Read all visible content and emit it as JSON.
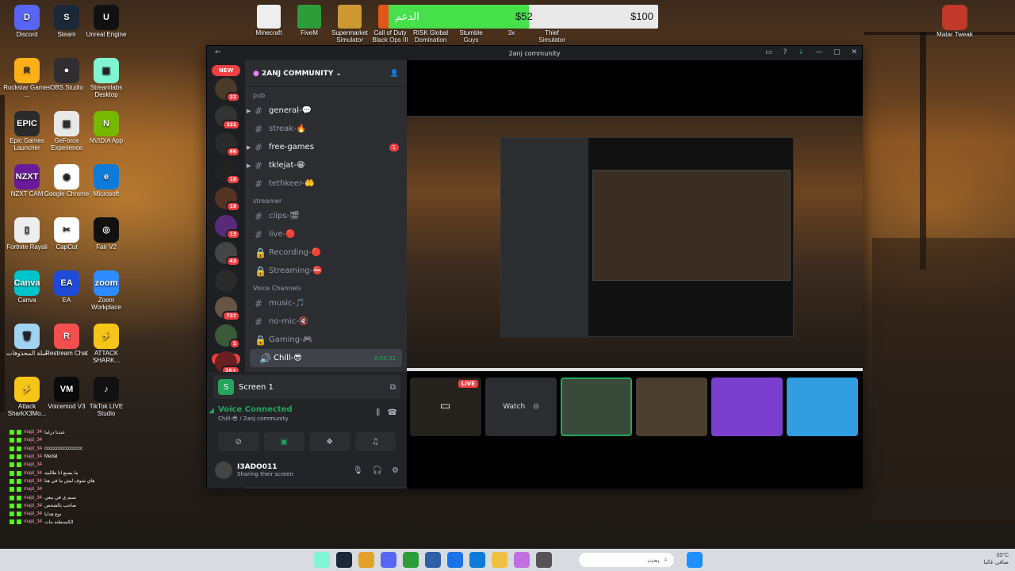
{
  "desktop": {
    "left_icons": [
      {
        "label": "Discord",
        "color": "#5865f2",
        "glyph": "D"
      },
      {
        "label": "Steam",
        "color": "#1b2838",
        "glyph": "S"
      },
      {
        "label": "Unreal Engine",
        "color": "#111111",
        "glyph": "U"
      },
      {
        "label": "Rockstar Games ...",
        "color": "#fcaf17",
        "glyph": "R"
      },
      {
        "label": "OBS Studio",
        "color": "#302e31",
        "glyph": "●"
      },
      {
        "label": "Streamlabs Desktop",
        "color": "#80f5d2",
        "glyph": "▣"
      },
      {
        "label": "Epic Games Launcher",
        "color": "#2a2a2a",
        "glyph": "EPIC"
      },
      {
        "label": "GeForce Experience",
        "color": "#e8e8e8",
        "glyph": "▥"
      },
      {
        "label": "NVIDIA App",
        "color": "#76b900",
        "glyph": "N"
      },
      {
        "label": "NZXT CAM",
        "color": "#6a1b9a",
        "glyph": "NZXT"
      },
      {
        "label": "Google Chrome",
        "color": "#ffffff",
        "glyph": "◉"
      },
      {
        "label": "Microsoft",
        "color": "#0f7bd8",
        "glyph": "e"
      },
      {
        "label": "Fortnite Rayali",
        "color": "#eeeeee",
        "glyph": "▯"
      },
      {
        "label": "CapCut",
        "color": "#ffffff",
        "glyph": "✂"
      },
      {
        "label": "Fair V2",
        "color": "#111111",
        "glyph": "◎"
      },
      {
        "label": "Canva",
        "color": "#00c4cc",
        "glyph": "Canva"
      },
      {
        "label": "EA",
        "color": "#1f4bd8",
        "glyph": "EA"
      },
      {
        "label": "Zoom Workplace",
        "color": "#2d8cff",
        "glyph": "zoom"
      },
      {
        "label": "سلة المحذوفات",
        "color": "#9fd3f0",
        "glyph": "🗑"
      },
      {
        "label": "Restream Chat",
        "color": "#f54e4e",
        "glyph": "R"
      },
      {
        "label": "ATTACK SHARK...",
        "color": "#f5c518",
        "glyph": "⚡"
      },
      {
        "label": "Attack SharkX3Mo...",
        "color": "#f5c518",
        "glyph": "⚡"
      },
      {
        "label": "Voicemod V3",
        "color": "#0a0a0a",
        "glyph": "VM"
      },
      {
        "label": "TikTok LIVE Studio",
        "color": "#111111",
        "glyph": "♪"
      }
    ],
    "top_icons": [
      {
        "label": "Minecraft",
        "color": "#eeeeee"
      },
      {
        "label": "FiveM",
        "color": "#2d9d3a"
      },
      {
        "label": "Supermarket Simulator",
        "color": "#cc9933"
      },
      {
        "label": "Call of Duty Black Ops III",
        "color": "#e0561b"
      },
      {
        "label": "RISK Global Domination",
        "color": "#7a2a2a"
      },
      {
        "label": "Stumble Guys",
        "color": "#4fa3f7"
      },
      {
        "label": "3x",
        "color": "#883333"
      },
      {
        "label": "Thief Simulator",
        "color": "#444444"
      }
    ],
    "right_icon": {
      "label": "Matar Tweak",
      "color": "#c0392b"
    }
  },
  "donation": {
    "label": "الدعم",
    "current": "$52",
    "goal": "$100",
    "progress": 0.52,
    "fill_color": "#45e04a"
  },
  "discord": {
    "window_title": "2anj community",
    "server_name": "2anj community",
    "guilds": [
      {
        "count": "22"
      },
      {
        "count": "231"
      },
      {
        "count": "66"
      },
      {
        "count": "10"
      },
      {
        "count": "19"
      },
      {
        "count": "13"
      },
      {
        "count": "43"
      },
      {
        "count": ""
      },
      {
        "count": "737"
      },
      {
        "count": "1"
      },
      {
        "count": "1K+"
      }
    ],
    "new_label": "NEW",
    "categories": [
      "pub",
      "streamer",
      "Voice Channels"
    ],
    "channels_pub": [
      {
        "name": "general-💬",
        "bright": true,
        "badge": ""
      },
      {
        "name": "streak-🔥",
        "bright": false,
        "badge": ""
      },
      {
        "name": "free-games",
        "bright": true,
        "badge": "1"
      },
      {
        "name": "tklejat-😁",
        "bright": true,
        "badge": ""
      },
      {
        "name": "tethkeer-🤲",
        "bright": false,
        "badge": ""
      }
    ],
    "channels_streamer": [
      {
        "name": "clips-🎬",
        "lock": false
      },
      {
        "name": "live-🔴",
        "lock": false
      },
      {
        "name": "Recording-🔴",
        "lock": true
      },
      {
        "name": "Streaming-⛔",
        "lock": true
      }
    ],
    "channels_voice": [
      {
        "name": "music-🎵",
        "lock": false
      },
      {
        "name": "no-mic-🔇",
        "lock": false
      },
      {
        "name": "Gaming-🎮",
        "lock": true
      }
    ],
    "active_voice": {
      "name": "Chill-😎",
      "time": "6:05:32"
    },
    "screen_row": "Screen 1",
    "voice_status": {
      "title": "Voice Connected",
      "subtitle": "Chill-😎 / 2anj community"
    },
    "user": {
      "name": "I3ADO011",
      "status": "Sharing their screen"
    },
    "stream_tiles": {
      "live": "LIVE",
      "watch": "Watch"
    }
  },
  "chat": {
    "user": "majd_34",
    "messages": [
      "عندنا دراما",
      "",
      "cccccccccccccccc",
      "Medal",
      "",
      "ما يصنع انا طالبيه",
      "هاي شوف ليش ما في هنا",
      "",
      "سبم ي في بيعي",
      "صاحب بالشخص",
      "نوع هدايا",
      "الكسنطنه بنات"
    ]
  },
  "taskbar": {
    "search_placeholder": "بحث",
    "temperature": "33°C",
    "weather": "صافي غالبا"
  }
}
